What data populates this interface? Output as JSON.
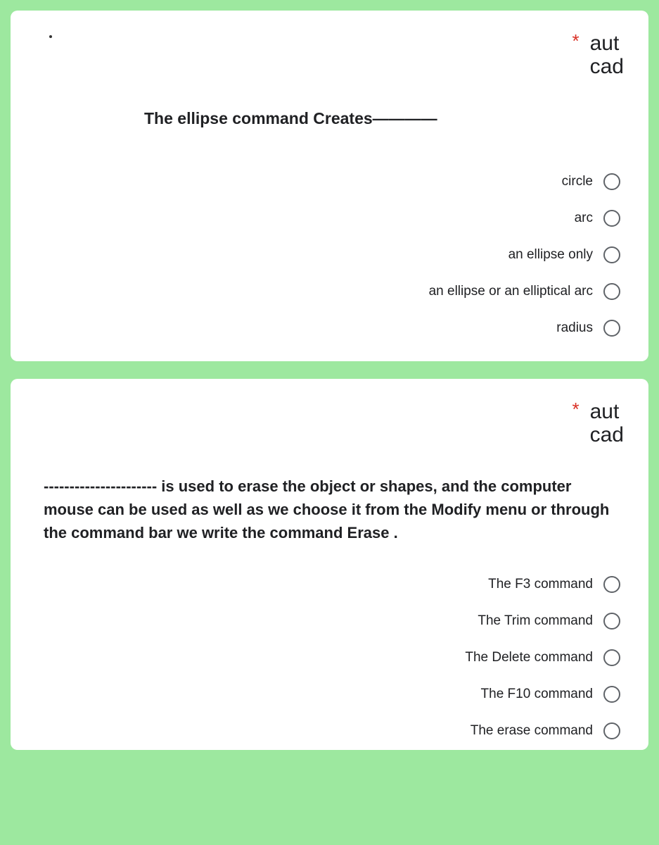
{
  "questions": [
    {
      "required_star": "*",
      "category_line1": "aut",
      "category_line2": "cad",
      "text": "The ellipse command Creates————",
      "options": [
        "circle",
        "arc",
        "an ellipse only",
        "an ellipse or an elliptical arc",
        "radius"
      ]
    },
    {
      "required_star": "*",
      "category_line1": "aut",
      "category_line2": "cad",
      "text": "---------------------- is used to erase the object or shapes, and the computer mouse can be used as well as we choose it from the Modify menu or through the command bar we write the command Erase .",
      "options": [
        "The F3 command",
        "The Trim command",
        "The Delete command",
        "The F10 command",
        "The erase command"
      ]
    }
  ]
}
